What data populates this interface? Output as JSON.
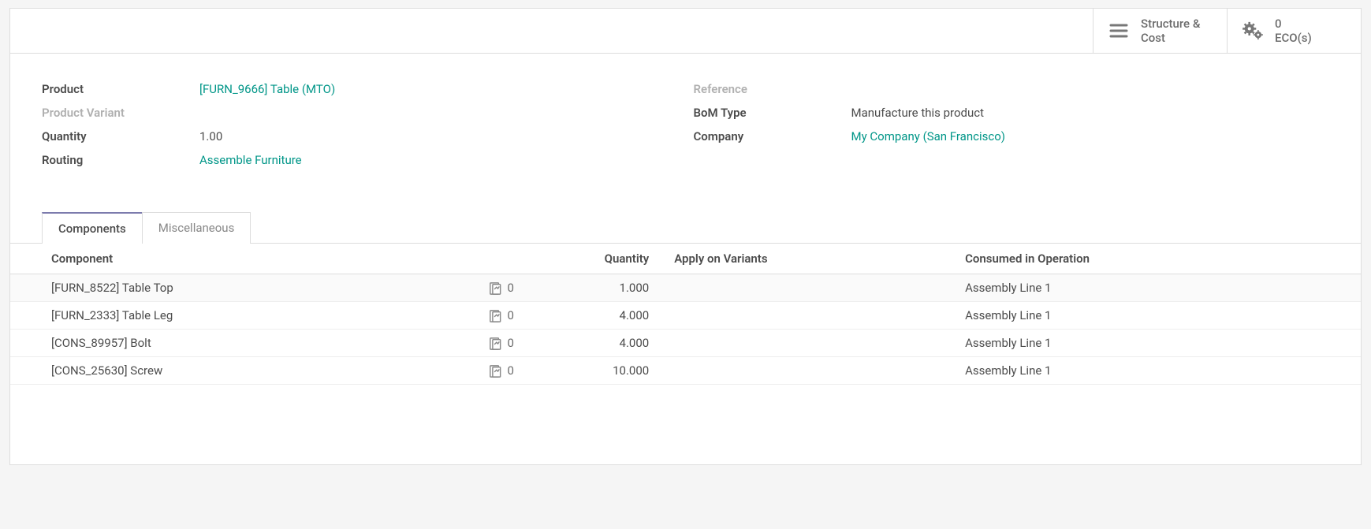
{
  "buttons": {
    "structure": {
      "line1": "Structure &",
      "line2": "Cost"
    },
    "eco": {
      "line1": "0",
      "line2": "ECO(s)"
    }
  },
  "form": {
    "left": {
      "product_label": "Product",
      "product_value": "[FURN_9666] Table (MTO)",
      "variant_label": "Product Variant",
      "variant_value": "",
      "quantity_label": "Quantity",
      "quantity_value": "1.00",
      "routing_label": "Routing",
      "routing_value": "Assemble Furniture"
    },
    "right": {
      "reference_label": "Reference",
      "reference_value": "",
      "bomtype_label": "BoM Type",
      "bomtype_value": "Manufacture this product",
      "company_label": "Company",
      "company_value": "My Company (San Francisco)"
    }
  },
  "tabs": {
    "components": "Components",
    "misc": "Miscellaneous"
  },
  "table": {
    "headers": {
      "component": "Component",
      "quantity": "Quantity",
      "variants": "Apply on Variants",
      "consumed": "Consumed in Operation"
    },
    "rows": [
      {
        "component": "[FURN_8522] Table Top",
        "forecast": "0",
        "quantity": "1.000",
        "variants": "",
        "consumed": "Assembly Line 1"
      },
      {
        "component": "[FURN_2333] Table Leg",
        "forecast": "0",
        "quantity": "4.000",
        "variants": "",
        "consumed": "Assembly Line 1"
      },
      {
        "component": "[CONS_89957] Bolt",
        "forecast": "0",
        "quantity": "4.000",
        "variants": "",
        "consumed": "Assembly Line 1"
      },
      {
        "component": "[CONS_25630] Screw",
        "forecast": "0",
        "quantity": "10.000",
        "variants": "",
        "consumed": "Assembly Line 1"
      }
    ]
  }
}
